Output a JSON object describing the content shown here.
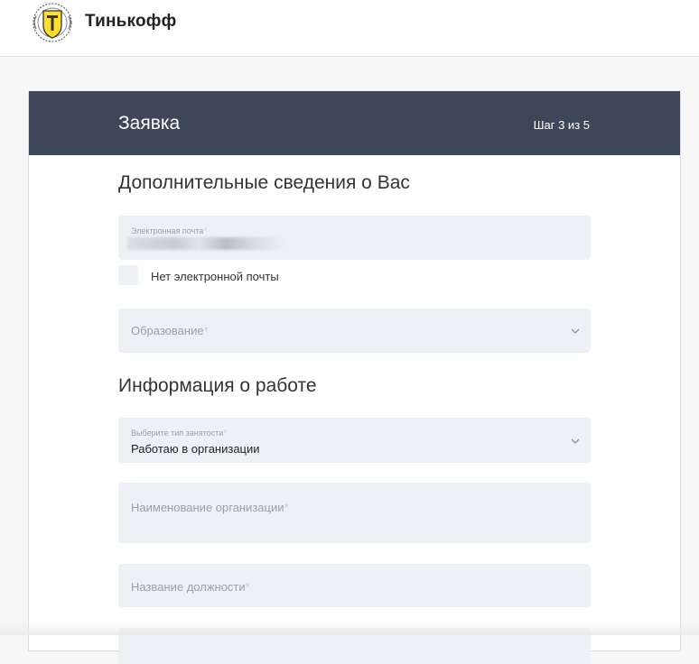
{
  "header": {
    "brand_name": "Тинькофф",
    "logo_icon": "tinkoff-shield-logo"
  },
  "form": {
    "title": "Заявка",
    "step": "Шаг 3 из 5",
    "section_additional": "Дополнительные сведения о Вас",
    "email": {
      "label": "Электронная почта",
      "required_mark": "*"
    },
    "no_email_checkbox": {
      "label": "Нет электронной почты",
      "checked": false
    },
    "education": {
      "placeholder": "Образование",
      "required_mark": "*"
    },
    "section_work": "Информация о работе",
    "employment_type": {
      "label": "Выберите тип занятости",
      "required_mark": "*",
      "value": "Работаю в организации"
    },
    "organization_name": {
      "placeholder": "Наименование организации",
      "required_mark": "*"
    },
    "position_name": {
      "placeholder": "Название должности",
      "required_mark": "*"
    }
  },
  "colors": {
    "header_bg": "#3e4759",
    "field_bg": "#edf1f6",
    "brand_yellow": "#ffdd2d"
  }
}
